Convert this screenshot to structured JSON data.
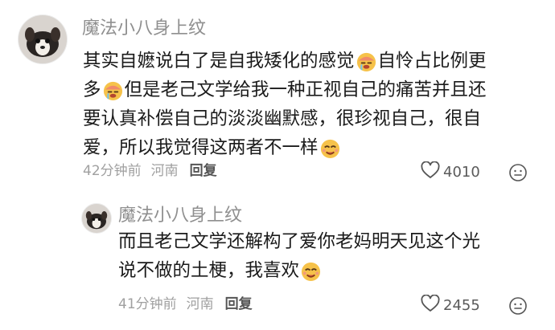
{
  "comment": {
    "username": "魔法小八身上纹",
    "text_segments": [
      [
        "其实自嬷说白了是自我矮化的感觉",
        "自怜占比例更"
      ],
      [
        "多",
        "但是老己文学给我一种正视自己的痛苦并且还"
      ],
      [
        "要认真补偿自己的淡淡幽默感，很珍视自己，很自"
      ],
      [
        "爱，所以我觉得这两者不一样"
      ]
    ],
    "time": "42分钟前",
    "location": "河南",
    "reply_label": "回复",
    "likes": "4010"
  },
  "reply": {
    "username": "魔法小八身上纹",
    "text_segments": [
      [
        "而且老己文学还解构了爱你老妈明天见这个光"
      ],
      [
        "说不做的土梗，我喜欢"
      ]
    ],
    "time": "41分钟前",
    "location": "河南",
    "reply_label": "回复",
    "likes": "2455"
  },
  "icons": {
    "heart": "heart-outline-icon",
    "face": "emoji-reaction-icon",
    "emoji_cry": "crying-emoji-icon",
    "emoji_wink": "smug-emoji-icon"
  }
}
